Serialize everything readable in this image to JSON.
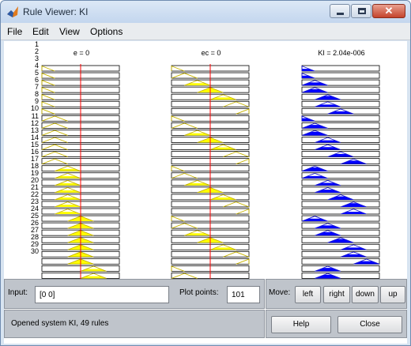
{
  "window": {
    "title": "Rule Viewer: KI"
  },
  "menu": [
    "File",
    "Edit",
    "View",
    "Options"
  ],
  "columns": [
    {
      "title": "e = 0",
      "line_frac": 0.5,
      "color": "#ffff00"
    },
    {
      "title": "ec = 0",
      "line_frac": 0.5,
      "color": "#ffff00"
    },
    {
      "title": "KI = 2.04e-006",
      "color": "#0000ff"
    }
  ],
  "rules": {
    "visible_numbers": [
      "1",
      "2",
      "3",
      "4",
      "5",
      "6",
      "7",
      "8",
      "9",
      "10",
      "11",
      "12",
      "13",
      "14",
      "15",
      "16",
      "17",
      "18",
      "19",
      "20",
      "21",
      "22",
      "23",
      "24",
      "25",
      "26",
      "27",
      "28",
      "29",
      "30"
    ],
    "e_sets": [
      0,
      0,
      0,
      0,
      0,
      0,
      0,
      1,
      1,
      1,
      1,
      1,
      1,
      1,
      2,
      2,
      2,
      2,
      2,
      2,
      2,
      3,
      3,
      3,
      3,
      3,
      3,
      3,
      4,
      4
    ],
    "ec_sets": [
      0,
      1,
      2,
      3,
      4,
      5,
      6,
      0,
      1,
      2,
      3,
      4,
      5,
      6,
      0,
      1,
      2,
      3,
      4,
      5,
      6,
      0,
      1,
      2,
      3,
      4,
      5,
      6,
      0,
      1
    ],
    "ki_sets": [
      0,
      0,
      1,
      1,
      2,
      2,
      3,
      0,
      1,
      1,
      2,
      2,
      3,
      4,
      1,
      1,
      2,
      2,
      3,
      4,
      4,
      1,
      2,
      2,
      3,
      4,
      4,
      5,
      2,
      2
    ]
  },
  "input": {
    "label": "Input:",
    "value": "[0 0]"
  },
  "plot_points": {
    "label": "Plot points:",
    "value": "101"
  },
  "move": {
    "label": "Move:",
    "buttons": [
      "left",
      "right",
      "down",
      "up"
    ]
  },
  "status": {
    "text": "Opened system KI, 49 rules"
  },
  "actions": {
    "help": "Help",
    "close": "Close"
  }
}
